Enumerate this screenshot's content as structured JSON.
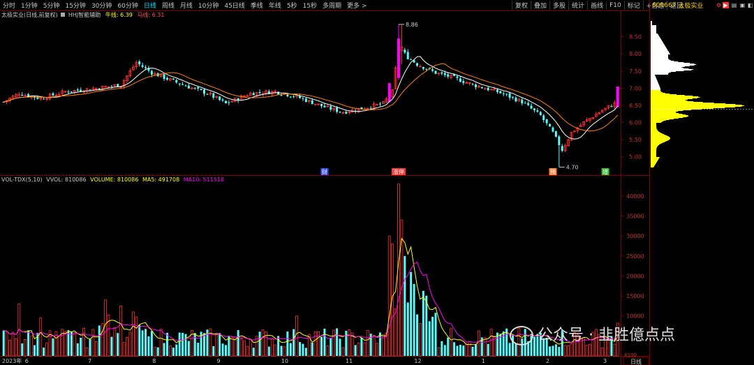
{
  "toolbar": {
    "periods": [
      "分时",
      "1分钟",
      "5分钟",
      "15分钟",
      "30分钟",
      "60分钟",
      "日线",
      "周线",
      "月线",
      "10分钟",
      "45日线",
      "季线",
      "年线",
      "5秒",
      "15秒",
      "多周期",
      "更多"
    ],
    "active": "日线",
    "right_buttons": [
      "复权",
      "叠加",
      "多股",
      "统计",
      "画线",
      "F10",
      "标记",
      "+自选",
      "返回"
    ]
  },
  "stock": {
    "code": "600667",
    "name": "太极实业"
  },
  "colors": {
    "up": "#ff3232",
    "down": "#54fcfc",
    "ma_fast": "#ffffff",
    "ma_slow": "#ff8000",
    "vol_ma5": "#ffff00",
    "vol_ma10": "#ff00ff",
    "limit_up": "#ff00ff",
    "chip_upper": "#ffffff",
    "chip_lower": "#ffff00"
  },
  "indicator_line": {
    "title": "太极实业(日线,前复权)",
    "helper": "HHJ智能辅助",
    "bull_label": "牛线: 6.39",
    "horse_label": "马线: 6.31"
  },
  "volume_line": {
    "title": "VOL-TDX(5,10)",
    "vvol": "VVOL: 810086",
    "volume": "VOLUME: 810086",
    "ma5": "MA5: 491708",
    "ma10": "MA10: 511518"
  },
  "price_axis": {
    "ticks": [
      "8.50",
      "8.00",
      "7.50",
      "7.00",
      "6.50",
      "6.00",
      "5.50",
      "5.00"
    ]
  },
  "volume_axis": {
    "ticks": [
      "40000",
      "35000",
      "30000",
      "25000",
      "20000",
      "15000",
      "10000"
    ],
    "unit": "X100"
  },
  "date_axis": {
    "labels": [
      "2023年",
      "6",
      "7",
      "8",
      "9",
      "10",
      "11",
      "12",
      "1",
      "2",
      "3"
    ],
    "period_label": "日线"
  },
  "annotations": {
    "high": "8.86",
    "low": "4.70",
    "tags": [
      "财",
      "涨停",
      "预",
      "增"
    ]
  },
  "watermark": {
    "text": "公众号 · 韭胜億点点"
  },
  "chart_data": {
    "type": "candlestick",
    "price_range": [
      4.75,
      8.9
    ],
    "volume_range": [
      0,
      44000
    ],
    "high_value": 8.86,
    "low_value": 4.7,
    "last_close": 6.39
  }
}
